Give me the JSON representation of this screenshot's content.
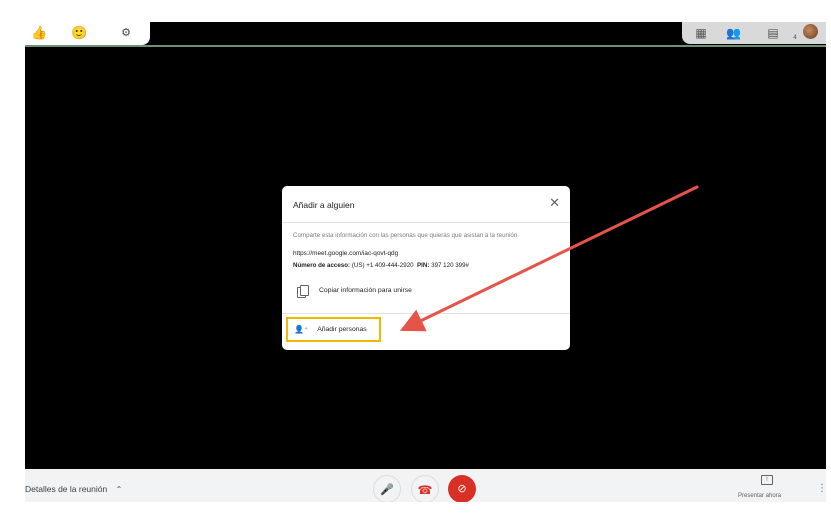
{
  "top_left_tray": {
    "icons": [
      "raise-hand-icon",
      "avatar-icon",
      "settings-icon"
    ],
    "glyphs": [
      "👍",
      "🙂",
      "⚙"
    ]
  },
  "top_right_tray": {
    "icons": [
      "grid-icon",
      "people-icon",
      "chat-icon",
      "user-avatar"
    ],
    "glyphs": [
      "▦",
      "👥",
      "▤",
      ""
    ],
    "badge": "4"
  },
  "dialog": {
    "title": "Añadir a alguien",
    "close_glyph": "✕",
    "share_info": "Comparte esta información con las personas que quieras que asistan a la reunión",
    "meet_link": "https://meet.google.com/iac-qovt-qdg",
    "dial_label": "Número de acceso:",
    "dial_number": "(US) +1 409-444-2920",
    "pin_label": "PIN:",
    "pin_value": "397 120 399#",
    "copy_label": "Copiar información para unirse",
    "add_people_glyph": "👤⁺",
    "add_people_label": "Añadir personas"
  },
  "bottom_bar": {
    "meeting_details": "Detalles de la reunión",
    "chevron": "⌃",
    "mic_glyph": "🎤",
    "end_glyph": "☎",
    "cam_glyph": "⊘",
    "present_label": "Presentar ahora",
    "present_glyph": "↑",
    "more_glyph": "⋮"
  },
  "colors": {
    "highlight_border": "#f1b800",
    "arrow": "#e5534b",
    "end_call_red": "#d93025"
  }
}
